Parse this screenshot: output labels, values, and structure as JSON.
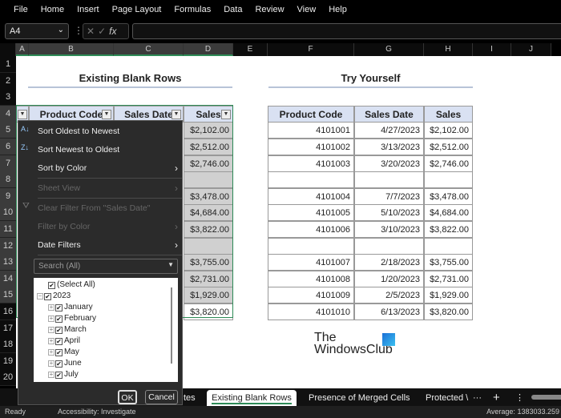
{
  "ribbon": {
    "tabs": [
      "File",
      "Home",
      "Insert",
      "Page Layout",
      "Formulas",
      "Data",
      "Review",
      "View",
      "Help"
    ]
  },
  "formula_bar": {
    "name_box": "A4",
    "fx": "fx",
    "formula": ""
  },
  "columns": [
    "A",
    "B",
    "C",
    "D",
    "E",
    "F",
    "G",
    "H",
    "I",
    "J"
  ],
  "rows": [
    "1",
    "2",
    "3",
    "4",
    "5",
    "6",
    "7",
    "8",
    "9",
    "10",
    "11",
    "12",
    "13",
    "14",
    "15",
    "16",
    "17",
    "18",
    "19",
    "20"
  ],
  "left_table": {
    "title": "Existing Blank Rows",
    "headers": [
      "Product Code",
      "Sales Date",
      "Sales"
    ],
    "sales": [
      "$2,102.00",
      "$2,512.00",
      "$2,746.00",
      "",
      "$3,478.00",
      "$4,684.00",
      "$3,822.00",
      "",
      "$3,755.00",
      "$2,731.00",
      "$1,929.00",
      "$3,820.00"
    ]
  },
  "right_table": {
    "title": "Try Yourself",
    "headers": [
      "Product Code",
      "Sales Date",
      "Sales"
    ],
    "rows": [
      [
        "4101001",
        "4/27/2023",
        "$2,102.00"
      ],
      [
        "4101002",
        "3/13/2023",
        "$2,512.00"
      ],
      [
        "4101003",
        "3/20/2023",
        "$2,746.00"
      ],
      [
        "",
        "",
        ""
      ],
      [
        "4101004",
        "7/7/2023",
        "$3,478.00"
      ],
      [
        "4101005",
        "5/10/2023",
        "$4,684.00"
      ],
      [
        "4101006",
        "3/10/2023",
        "$3,822.00"
      ],
      [
        "",
        "",
        ""
      ],
      [
        "4101007",
        "2/18/2023",
        "$3,755.00"
      ],
      [
        "4101008",
        "1/20/2023",
        "$2,731.00"
      ],
      [
        "4101009",
        "2/5/2023",
        "$1,929.00"
      ],
      [
        "4101010",
        "6/13/2023",
        "$3,820.00"
      ]
    ]
  },
  "filter_menu": {
    "items": [
      {
        "label": "Sort Oldest to Newest",
        "enabled": true,
        "icon": "sort-ascending-icon"
      },
      {
        "label": "Sort Newest to Oldest",
        "enabled": true,
        "icon": "sort-descending-icon"
      },
      {
        "label": "Sort by Color",
        "enabled": true
      },
      {
        "label": "Sheet View",
        "enabled": false
      },
      {
        "label": "Clear Filter From \"Sales Date\"",
        "enabled": false,
        "icon": "clear-filter-icon"
      },
      {
        "label": "Filter by Color",
        "enabled": false
      },
      {
        "label": "Date Filters",
        "enabled": true
      }
    ],
    "search_placeholder": "Search (All)",
    "tree": {
      "select_all": "(Select All)",
      "year": "2023",
      "months": [
        "January",
        "February",
        "March",
        "April",
        "May",
        "June",
        "July"
      ]
    },
    "ok": "OK",
    "cancel": "Cancel"
  },
  "watermark": {
    "line1": "The",
    "line2": "WindowsClub"
  },
  "sheet_tabs": {
    "partial": "tes",
    "tabs": [
      "Existing Blank Rows",
      "Presence of Merged Cells",
      "Protected \\"
    ],
    "active": "Existing Blank Rows",
    "more": "···",
    "add": "+"
  },
  "status": {
    "ready": "Ready",
    "accessibility": "Accessibility: Investigate",
    "average": "Average: 1383033.259"
  },
  "colors": {
    "header_fill": "#d9e1f2",
    "selection": "#2e8b57",
    "menu_bg": "#2b2b2b"
  }
}
